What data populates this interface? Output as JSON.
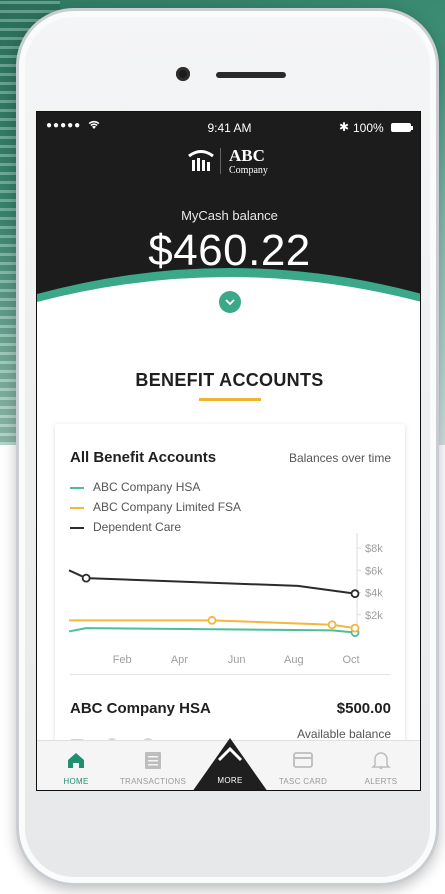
{
  "status_bar": {
    "signal": "●●●●●",
    "time": "9:41 AM",
    "bluetooth": "✱",
    "battery": "100%"
  },
  "header": {
    "logo_name": "ABC",
    "logo_sub": "Company",
    "balance_label": "MyCash balance",
    "balance": "$460.22",
    "expand_icon": "chevron-down-icon"
  },
  "benefit_accounts": {
    "title": "BENEFIT ACCOUNTS"
  },
  "card": {
    "title": "All Benefit Accounts",
    "subtitle": "Balances over time",
    "hsa": {
      "name": "ABC Company HSA",
      "amount": "$500.00",
      "available_label": "Available balance"
    }
  },
  "chart_data": {
    "type": "line",
    "title": "All Benefit Accounts",
    "xlabel": "",
    "ylabel": "",
    "x_ticks": [
      "Feb",
      "Apr",
      "Jun",
      "Aug",
      "Oct"
    ],
    "y_ticks": [
      "$2k",
      "$4k",
      "$6k",
      "$8k"
    ],
    "ylim": [
      0,
      9000
    ],
    "xlim": [
      0,
      10
    ],
    "grid": false,
    "legend": "top-left",
    "series": [
      {
        "name": "ABC Company HSA",
        "color": "#4dbd9c",
        "x": [
          0,
          0.6,
          9.2,
          10
        ],
        "y": [
          500,
          800,
          600,
          400
        ],
        "markers": [
          false,
          false,
          false,
          true
        ]
      },
      {
        "name": "ABC Company Limited FSA",
        "color": "#f4b63d",
        "x": [
          0,
          1.5,
          5,
          9.2,
          10
        ],
        "y": [
          1500,
          1500,
          1500,
          1100,
          800
        ],
        "markers": [
          false,
          false,
          true,
          true,
          true
        ]
      },
      {
        "name": "Dependent Care",
        "color": "#2b2b2b",
        "x": [
          0,
          0.6,
          8,
          10
        ],
        "y": [
          6000,
          5300,
          4600,
          3900
        ],
        "markers": [
          false,
          true,
          false,
          true
        ]
      }
    ]
  },
  "tabbar": {
    "items": [
      {
        "label": "HOME",
        "icon": "home-icon",
        "active": true
      },
      {
        "label": "TRANSACTIONS",
        "icon": "list-icon",
        "active": false
      },
      {
        "label": "MORE",
        "icon": "chevron-up-icon",
        "active": false
      },
      {
        "label": "TASC CARD",
        "icon": "card-icon",
        "active": false
      },
      {
        "label": "ALERTS",
        "icon": "bell-icon",
        "active": false
      }
    ]
  },
  "colors": {
    "accent_green": "#3aa889",
    "accent_yellow": "#f2b232",
    "header_dark": "#1c1c1c"
  }
}
